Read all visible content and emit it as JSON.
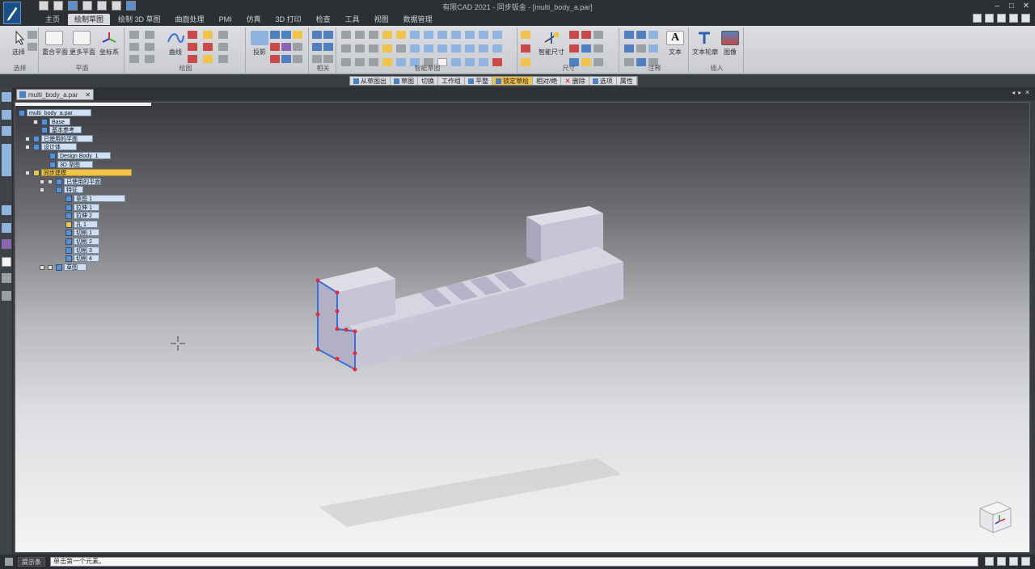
{
  "app": {
    "window_title": "有限CAD 2021 - 同步钣金 - [multi_body_a.par]"
  },
  "ribbon": {
    "tabs": [
      {
        "label": "主页"
      },
      {
        "label": "绘制草图"
      },
      {
        "label": "绘制 3D 草图"
      },
      {
        "label": "曲面处理"
      },
      {
        "label": "PMI"
      },
      {
        "label": "仿真"
      },
      {
        "label": "3D 打印"
      },
      {
        "label": "检查"
      },
      {
        "label": "工具"
      },
      {
        "label": "视图"
      },
      {
        "label": "数据管理"
      }
    ],
    "active_tab_index": 1,
    "groups": {
      "select": {
        "button": "选择",
        "label": "选择"
      },
      "plane": {
        "buttons": [
          "重合平面",
          "更多平面",
          "坐标系"
        ],
        "label": "平面"
      },
      "draw": {
        "curve": "曲线",
        "label": "绘图"
      },
      "project": {
        "button": "投影",
        "label": ""
      },
      "relate": {
        "label": "相关"
      },
      "intelli": {
        "label": "智能草图"
      },
      "dimension": {
        "button": "智能尺寸",
        "label": "尺寸"
      },
      "annotation": {
        "text": "文本",
        "label": "注释"
      },
      "insert": {
        "text_profile": "文本轮廓",
        "image": "图像",
        "label": "插入"
      }
    }
  },
  "command_bar": {
    "items": [
      {
        "label": "从草图出",
        "active": false
      },
      {
        "label": "草图",
        "active": false
      },
      {
        "label": "切换",
        "active": false
      },
      {
        "label": "工作组",
        "active": false
      },
      {
        "label": "平整",
        "active": false
      },
      {
        "label": "锁定草绘",
        "active": true
      },
      {
        "label": "相对/绝",
        "active": false
      },
      {
        "label": "删除",
        "active": false
      },
      {
        "label": "选项",
        "active": false
      },
      {
        "label": "属性",
        "active": false
      }
    ]
  },
  "document": {
    "tab_label": "multi_body_a.par"
  },
  "tree": {
    "items": [
      {
        "label": "multi_body_a.par",
        "depth": 0,
        "expander": false,
        "selected": false
      },
      {
        "label": "Base",
        "depth": 1,
        "expander": true,
        "selected": false
      },
      {
        "label": "基本参考",
        "depth": 1,
        "expander": false,
        "selected": false
      },
      {
        "label": "已使用的平面",
        "depth": 1,
        "expander": true,
        "selected": false
      },
      {
        "label": "设计体",
        "depth": 1,
        "expander": true,
        "selected": false
      },
      {
        "label": "Design Body_1",
        "depth": 2,
        "expander": false,
        "selected": false
      },
      {
        "label": "3D 草图",
        "depth": 2,
        "expander": false,
        "selected": false
      },
      {
        "label": "同步建模",
        "depth": 1,
        "expander": true,
        "selected": true
      },
      {
        "label": "已使用的平面",
        "depth": 2,
        "expander": true,
        "selected": false
      },
      {
        "label": "特征",
        "depth": 2,
        "expander": true,
        "selected": false
      },
      {
        "label": "草图 1",
        "depth": 3,
        "expander": false,
        "selected": false
      },
      {
        "label": "拉伸 1",
        "depth": 3,
        "expander": false,
        "selected": false
      },
      {
        "label": "拉伸 2",
        "depth": 3,
        "expander": false,
        "selected": false
      },
      {
        "label": "孔 1",
        "depth": 3,
        "expander": false,
        "selected": false
      },
      {
        "label": "切削 1",
        "depth": 3,
        "expander": false,
        "selected": false
      },
      {
        "label": "切削 2",
        "depth": 3,
        "expander": false,
        "selected": false
      },
      {
        "label": "切削 3",
        "depth": 3,
        "expander": false,
        "selected": false
      },
      {
        "label": "切削 4",
        "depth": 3,
        "expander": false,
        "selected": false
      },
      {
        "label": "草图",
        "depth": 2,
        "expander": true,
        "selected": false
      }
    ]
  },
  "prompt": {
    "label": "提示条",
    "text": "单击第一个元素。"
  },
  "colors": {
    "accent": "#f0c34a",
    "model_face": "#c7c5d6",
    "sketch_line": "#3b6fd8",
    "sketch_point": "#e0303a"
  },
  "icons": {
    "app": "pen-logo-icon",
    "view_cube": "view-cube-icon",
    "cursor": "crosshair-cursor-icon"
  }
}
